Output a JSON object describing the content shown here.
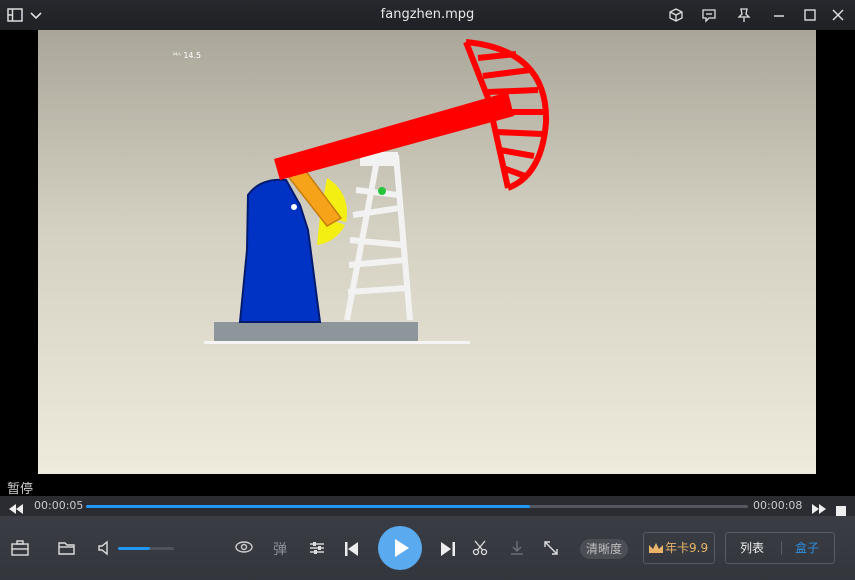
{
  "window": {
    "title": "fangzhen.mpg"
  },
  "video": {
    "watermark": "ᴹᴬ 14.5"
  },
  "status": {
    "text": "暂停"
  },
  "playback": {
    "current_time": "00:00:05",
    "total_time": "00:00:08",
    "progress": 0.671
  },
  "volume": {
    "level": 0.58
  },
  "controls": {
    "danmaku_label": "弹",
    "quality_label": "清晰度",
    "promo_label": "年卡9.9",
    "list_label": "列表",
    "box_label": "盒子"
  },
  "colors": {
    "accent": "#2196f3",
    "promo": "#e8b46a",
    "play_button": "#5aaaf0"
  }
}
